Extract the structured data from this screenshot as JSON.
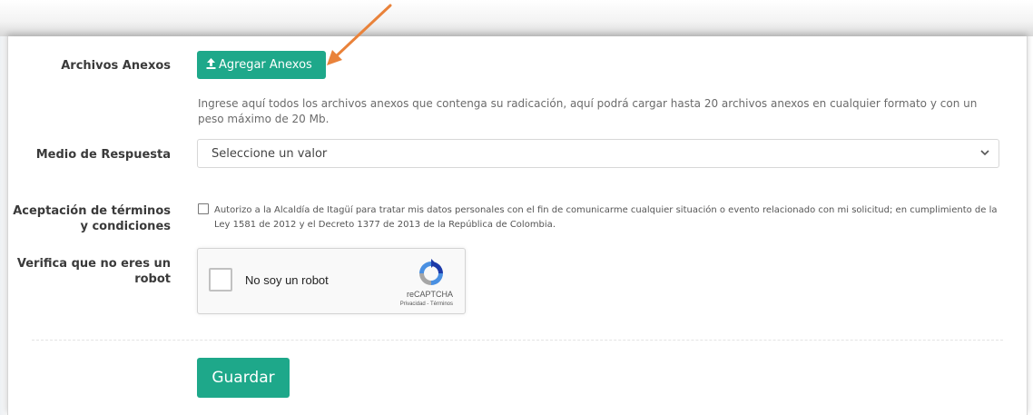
{
  "form": {
    "anexos": {
      "label": "Archivos Anexos",
      "button_label": "Agregar Anexos",
      "help_text": "Ingrese aquí todos los archivos anexos que contenga su radicación, aquí podrá cargar hasta 20 archivos anexos en cualquier formato y con un peso máximo de 20 Mb."
    },
    "medio": {
      "label": "Medio de Respuesta",
      "selected": "Seleccione un valor"
    },
    "terms": {
      "label_line1": "Aceptación de términos",
      "label_line2": "y condiciones",
      "text_line1": "Autorizo a la Alcaldía de Itagüí para tratar mis datos personales con el fin de comunicarme cualquier situación o evento relacionado con mi solicitud; en cumplimiento de la",
      "text_line2": "Ley 1581 de 2012 y el Decreto 1377 de 2013 de la República de Colombia."
    },
    "robot": {
      "label_line1": "Verifica que no eres un",
      "label_line2": "robot",
      "checkbox_text": "No soy un robot",
      "brand": "reCAPTCHA",
      "links": "Privacidad - Términos"
    },
    "submit_label": "Guardar"
  },
  "colors": {
    "accent": "#1ea88a",
    "annotation_arrow": "#e9823a"
  },
  "icons": {
    "upload": "upload-icon",
    "chevron": "chevron-down-icon",
    "recaptcha": "recaptcha-logo"
  }
}
